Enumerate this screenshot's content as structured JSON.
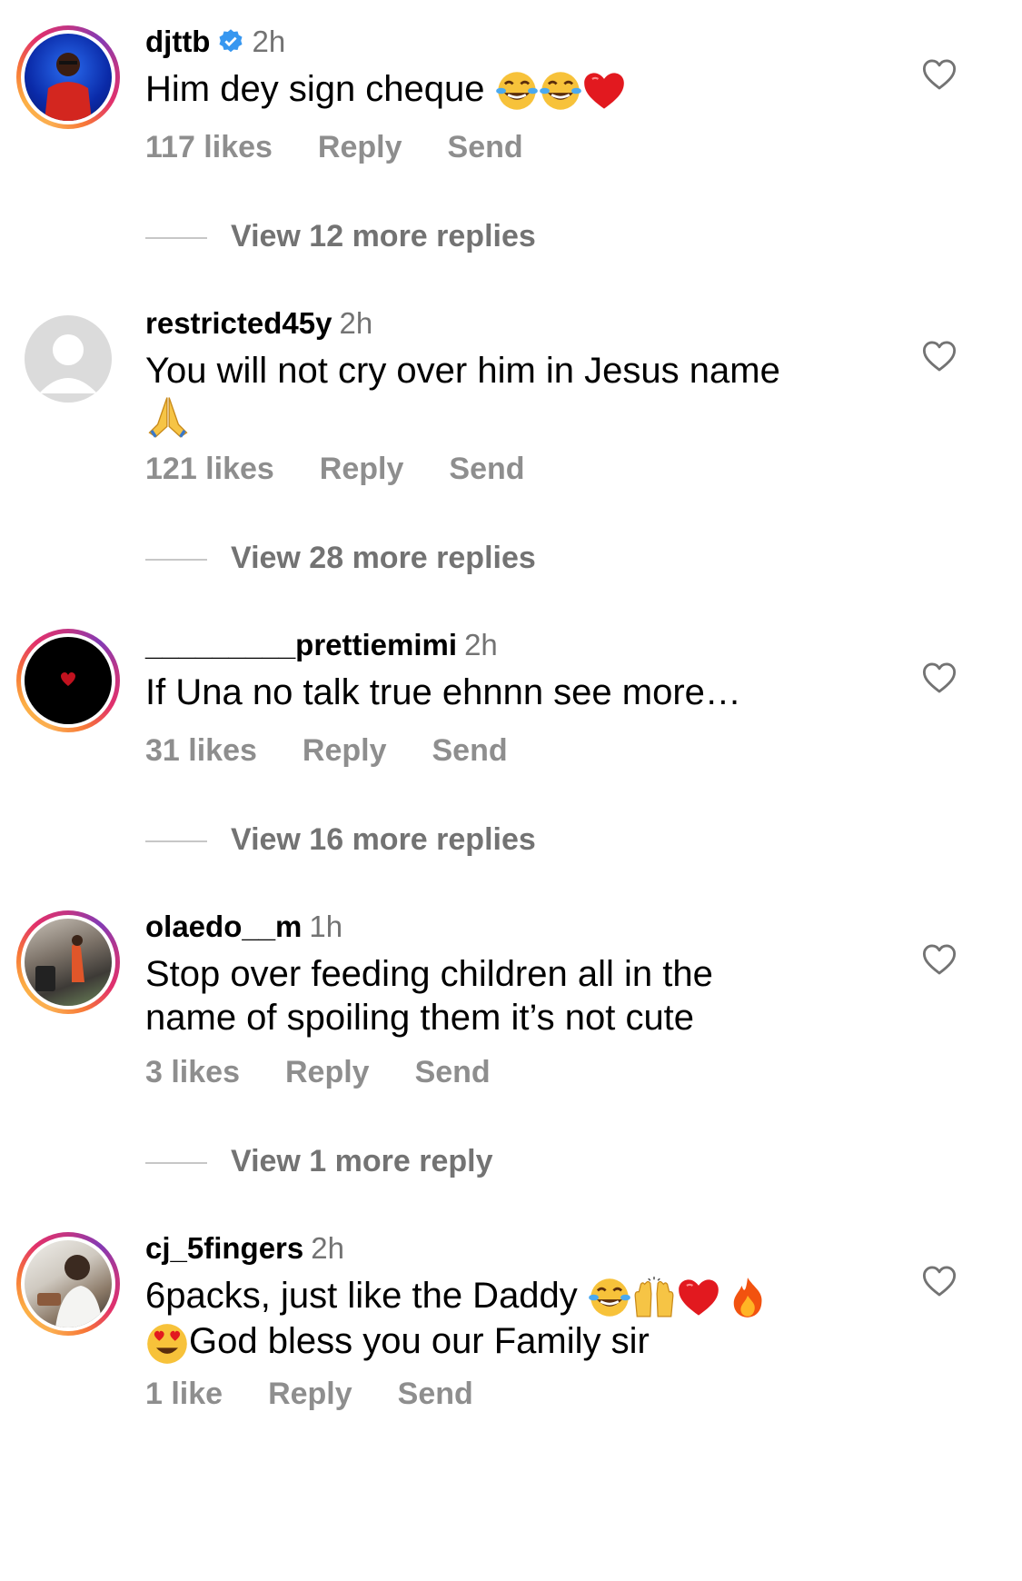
{
  "comments": [
    {
      "username": "djttb",
      "verified": true,
      "time": "2h",
      "text": "Him dey sign cheque",
      "emojis": [
        "laughing-tears-emoji",
        "laughing-tears-emoji",
        "red-heart-emoji"
      ],
      "likes": "117 likes",
      "reply": "Reply",
      "send": "Send",
      "view_replies": "View 12 more replies"
    },
    {
      "username": "restricted45y",
      "time": "2h",
      "text": "You will not cry over him in Jesus name",
      "emojis": [
        "praying-hands-emoji"
      ],
      "likes": "121 likes",
      "reply": "Reply",
      "send": "Send",
      "view_replies": "View 28 more replies"
    },
    {
      "username": "_________prettiemimi",
      "time": "2h",
      "text": "If Una no talk true ehnnn see more…",
      "likes": "31 likes",
      "reply": "Reply",
      "send": "Send",
      "view_replies": "View 16 more replies"
    },
    {
      "username": "olaedo__m",
      "time": "1h",
      "text_line1": "Stop over feeding children all in the",
      "text_line2": "name of spoiling them it’s not cute",
      "likes": "3 likes",
      "reply": "Reply",
      "send": "Send",
      "view_replies": "View 1 more reply"
    },
    {
      "username": "cj_5fingers",
      "time": "2h",
      "text_line1": "6packs, just like the Daddy",
      "text_line2": "God bless you our Family sir",
      "emojis": [
        "laughing-tears-emoji",
        "raised-hands-emoji",
        "red-heart-emoji",
        "fire-emoji",
        "heart-eyes-emoji"
      ],
      "likes": "1 like",
      "reply": "Reply",
      "send": "Send"
    }
  ],
  "colors": {
    "secondary_text": "#8e8e8e",
    "verified_blue": "#0095f6"
  }
}
